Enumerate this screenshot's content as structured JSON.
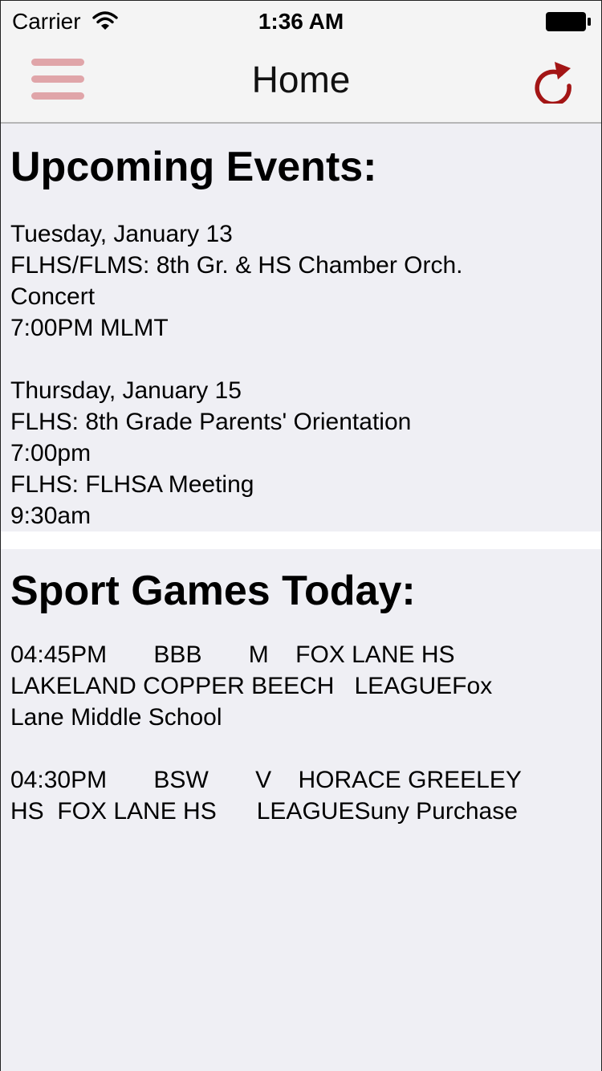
{
  "status_bar": {
    "carrier": "Carrier",
    "time": "1:36 AM",
    "icons": [
      "wifi-icon",
      "battery-icon"
    ]
  },
  "nav": {
    "title": "Home",
    "menu_icon": "hamburger-menu-icon",
    "refresh_icon": "refresh-icon",
    "menu_color": "#e0a5a9",
    "refresh_color": "#a31515"
  },
  "events": {
    "heading": "Upcoming Events:",
    "groups": [
      {
        "date": "Tuesday, January 13",
        "items": [
          {
            "title_l1": "FLHS/FLMS: 8th Gr. & HS Chamber Orch.",
            "title_l2": "Concert",
            "time": "7:00PM MLMT"
          }
        ]
      },
      {
        "date": "Thursday, January 15",
        "items": [
          {
            "title": "FLHS: 8th Grade Parents' Orientation",
            "time": "7:00pm"
          },
          {
            "title": "FLHS: FLHSA Meeting",
            "time": "9:30am"
          }
        ]
      }
    ]
  },
  "sports": {
    "heading": "Sport Games Today:",
    "games": [
      {
        "line1": "04:45PM       BBB       M    FOX LANE HS",
        "line2": "LAKELAND COPPER BEECH   LEAGUEFox",
        "line3": "Lane Middle School"
      },
      {
        "line1": "04:30PM       BSW       V    HORACE GREELEY",
        "line2": "HS  FOX LANE HS      LEAGUESuny Purchase"
      }
    ]
  }
}
